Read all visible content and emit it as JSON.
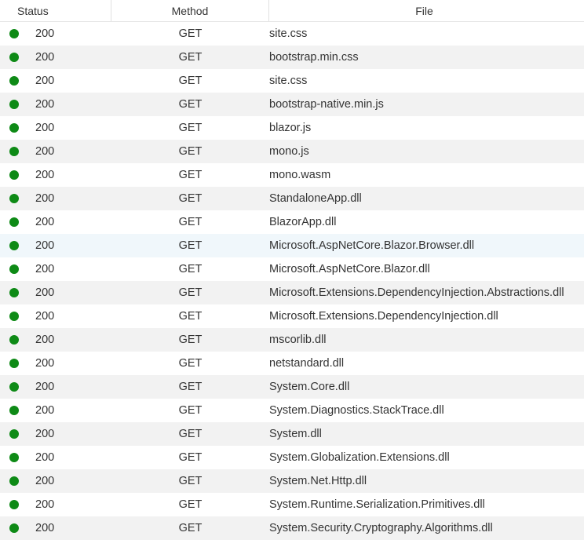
{
  "columns": {
    "status": "Status",
    "method": "Method",
    "file": "File"
  },
  "colors": {
    "status_ok": "#0e8a16",
    "row_alt": "#f2f2f2",
    "row_hover": "#f0f7fb"
  },
  "rows": [
    {
      "status": "200",
      "method": "GET",
      "file": "site.css"
    },
    {
      "status": "200",
      "method": "GET",
      "file": "bootstrap.min.css"
    },
    {
      "status": "200",
      "method": "GET",
      "file": "site.css"
    },
    {
      "status": "200",
      "method": "GET",
      "file": "bootstrap-native.min.js"
    },
    {
      "status": "200",
      "method": "GET",
      "file": "blazor.js"
    },
    {
      "status": "200",
      "method": "GET",
      "file": "mono.js"
    },
    {
      "status": "200",
      "method": "GET",
      "file": "mono.wasm"
    },
    {
      "status": "200",
      "method": "GET",
      "file": "StandaloneApp.dll"
    },
    {
      "status": "200",
      "method": "GET",
      "file": "BlazorApp.dll"
    },
    {
      "status": "200",
      "method": "GET",
      "file": "Microsoft.AspNetCore.Blazor.Browser.dll"
    },
    {
      "status": "200",
      "method": "GET",
      "file": "Microsoft.AspNetCore.Blazor.dll"
    },
    {
      "status": "200",
      "method": "GET",
      "file": "Microsoft.Extensions.DependencyInjection.Abstractions.dll"
    },
    {
      "status": "200",
      "method": "GET",
      "file": "Microsoft.Extensions.DependencyInjection.dll"
    },
    {
      "status": "200",
      "method": "GET",
      "file": "mscorlib.dll"
    },
    {
      "status": "200",
      "method": "GET",
      "file": "netstandard.dll"
    },
    {
      "status": "200",
      "method": "GET",
      "file": "System.Core.dll"
    },
    {
      "status": "200",
      "method": "GET",
      "file": "System.Diagnostics.StackTrace.dll"
    },
    {
      "status": "200",
      "method": "GET",
      "file": "System.dll"
    },
    {
      "status": "200",
      "method": "GET",
      "file": "System.Globalization.Extensions.dll"
    },
    {
      "status": "200",
      "method": "GET",
      "file": "System.Net.Http.dll"
    },
    {
      "status": "200",
      "method": "GET",
      "file": "System.Runtime.Serialization.Primitives.dll"
    },
    {
      "status": "200",
      "method": "GET",
      "file": "System.Security.Cryptography.Algorithms.dll"
    }
  ]
}
